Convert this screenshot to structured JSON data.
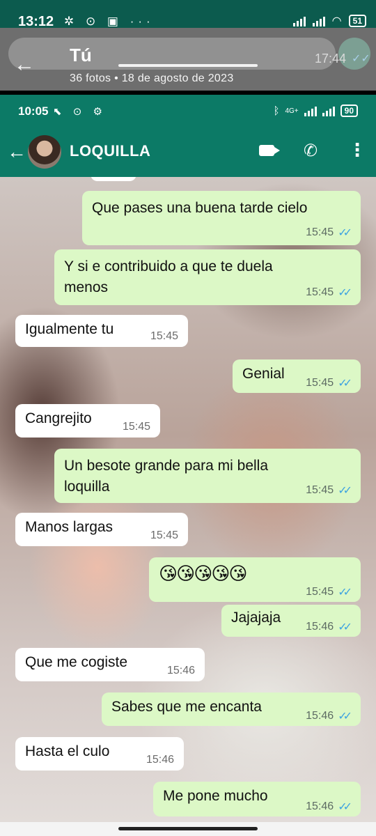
{
  "outer_status": {
    "time": "13:12",
    "icons_left": "✲ ⊙ ▣ ···",
    "battery": "51"
  },
  "viewer": {
    "title": "Tú",
    "back_icon": "←",
    "meta": "36 fotos  •  18 de agosto de 2023",
    "ghost_time": "17:44",
    "ghost_tick": "✓✓"
  },
  "inner_status": {
    "time": "10:05",
    "icons_left": "⬉ ⊙ ⚙",
    "network": "4G+",
    "battery": "90"
  },
  "chat_header": {
    "name": "LOQUILLA",
    "back_icon": "←",
    "call_icon": "✆",
    "menu_icon": "⋮"
  },
  "messages": [
    {
      "dir": "out",
      "text": "Que pases una buena tarde cielo",
      "time": "15:45",
      "ticks": "✓✓"
    },
    {
      "dir": "out",
      "text": "Y si e contribuido a que te duela\nmenos",
      "time": "15:45",
      "ticks": "✓✓"
    },
    {
      "dir": "in",
      "text": "Igualmente tu",
      "time": "15:45"
    },
    {
      "dir": "out",
      "text": "Genial",
      "time": "15:45",
      "ticks": "✓✓"
    },
    {
      "dir": "in",
      "text": "Cangrejito",
      "time": "15:45"
    },
    {
      "dir": "out",
      "text": "Un besote grande para mi bella\nloquilla",
      "time": "15:45",
      "ticks": "✓✓"
    },
    {
      "dir": "in",
      "text": "Manos largas",
      "time": "15:45"
    },
    {
      "dir": "out",
      "text": "😘😘😘😘😘",
      "time": "15:45",
      "ticks": "✓✓"
    },
    {
      "dir": "out",
      "text": "Jajajaja",
      "time": "15:46",
      "ticks": "✓✓"
    },
    {
      "dir": "in",
      "text": "Que me cogiste",
      "time": "15:46"
    },
    {
      "dir": "out",
      "text": "Sabes que me encanta",
      "time": "15:46",
      "ticks": "✓✓"
    },
    {
      "dir": "in",
      "text": "Hasta el culo",
      "time": "15:46"
    },
    {
      "dir": "out",
      "text": "Me pone mucho",
      "time": "15:46",
      "ticks": "✓✓"
    }
  ],
  "colors": {
    "header": "#0c7a66",
    "out_bubble": "#dcf8c6",
    "in_bubble": "#ffffff",
    "read_tick": "#3ea3e0"
  }
}
